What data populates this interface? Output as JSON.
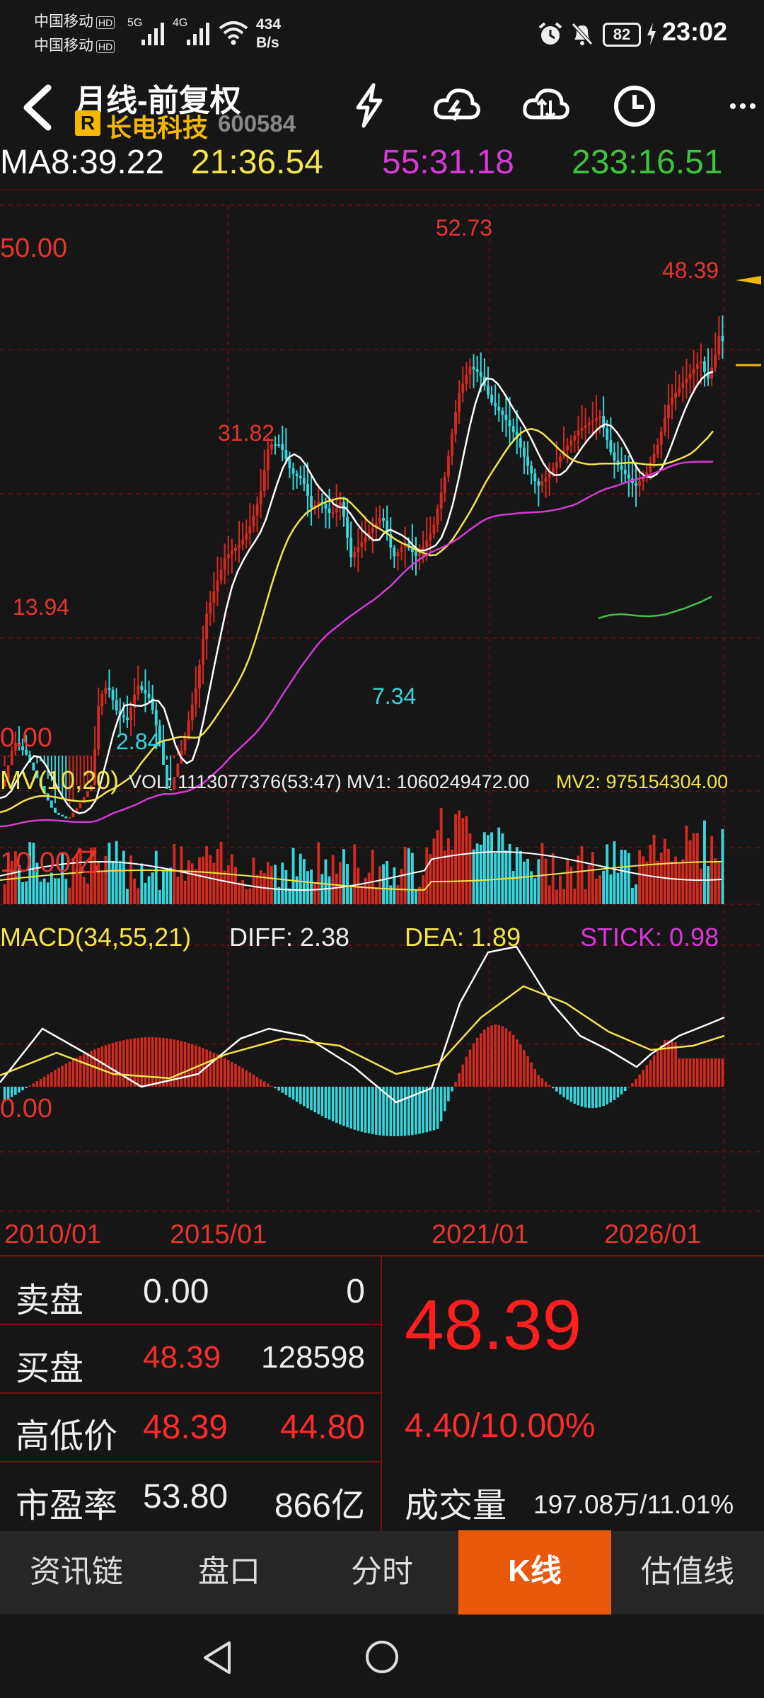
{
  "status_bar": {
    "carrier1": "中国移动",
    "carrier2": "中国移动",
    "hd": "HD",
    "net_5g": "5G",
    "net_4g": "4G",
    "speed_value": "434",
    "speed_unit": "B/s",
    "battery": "82",
    "time": "23:02"
  },
  "header": {
    "title": "月线-前复权",
    "badge": "R",
    "stock_name": "长电科技",
    "stock_code": "600584"
  },
  "ma": {
    "ma8": "MA8:39.22",
    "ma21": "21:36.54",
    "ma55": "55:31.18",
    "ma233": "233:16.51"
  },
  "price_chart": {
    "y_top": "50.00",
    "y_bottom": "0.00",
    "marks": {
      "high": "52.73",
      "current": "48.39",
      "peak_2015": "31.82",
      "peak_2010": "13.94",
      "low_2012": "2.84",
      "low_2018": "7.34"
    }
  },
  "volume_panel": {
    "title": "MV(10,20)",
    "vol": "VOL: 1113077376(53:47)",
    "mv1": "MV1: 1060249472.00",
    "mv2": "MV2: 975154304.00",
    "scale": "10.00亿"
  },
  "macd_panel": {
    "title": "MACD(34,55,21)",
    "diff": "DIFF: 2.38",
    "dea": "DEA: 1.89",
    "stick": "STICK: 0.98",
    "zero": "0.00"
  },
  "dates": [
    "2010/01",
    "2015/01",
    "2021/01",
    "2026/01"
  ],
  "quote": {
    "sell_label": "卖盘",
    "sell_price": "0.00",
    "sell_vol": "0",
    "buy_label": "买盘",
    "buy_price": "48.39",
    "buy_vol": "128598",
    "hl_label": "高低价",
    "high": "48.39",
    "low": "44.80",
    "pe_label": "市盈率",
    "pe": "53.80",
    "mcap": "866亿",
    "last_price": "48.39",
    "change": "4.40/10.00%",
    "volume_label": "成交量",
    "volume": "197.08万/11.01%"
  },
  "tabs": [
    "资讯链",
    "盘口",
    "分时",
    "K线",
    "估值线"
  ],
  "active_tab": "K线",
  "colors": {
    "up": "#d42a1e",
    "down": "#36d6dc",
    "ma8": "#ffffff",
    "ma21": "#f2e44a",
    "ma55": "#d63ad6",
    "ma233": "#3fc23f",
    "accent": "#e8590c"
  }
}
